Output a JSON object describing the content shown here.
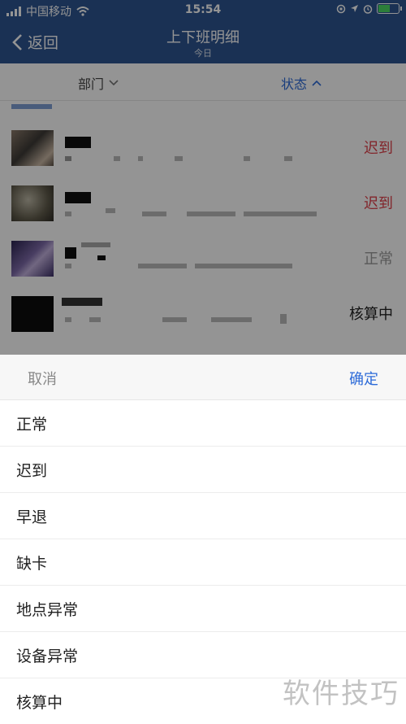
{
  "status_bar": {
    "carrier": "中国移动",
    "time": "15:54"
  },
  "nav": {
    "back_label": "返回",
    "title": "上下班明细",
    "subtitle": "今日"
  },
  "filters": {
    "department_label": "部门",
    "status_label": "状态"
  },
  "list": {
    "rows": [
      {
        "status": "迟到"
      },
      {
        "status": "迟到"
      },
      {
        "status": "正常"
      },
      {
        "status": "核算中"
      }
    ]
  },
  "picker": {
    "cancel_label": "取消",
    "confirm_label": "确定",
    "options": [
      "正常",
      "迟到",
      "早退",
      "缺卡",
      "地点异常",
      "设备异常",
      "核算中"
    ]
  },
  "watermark": "软件技巧",
  "colors": {
    "header_bg": "#2d5591",
    "accent_blue": "#2d6bd8",
    "late_red": "#e0404a"
  }
}
